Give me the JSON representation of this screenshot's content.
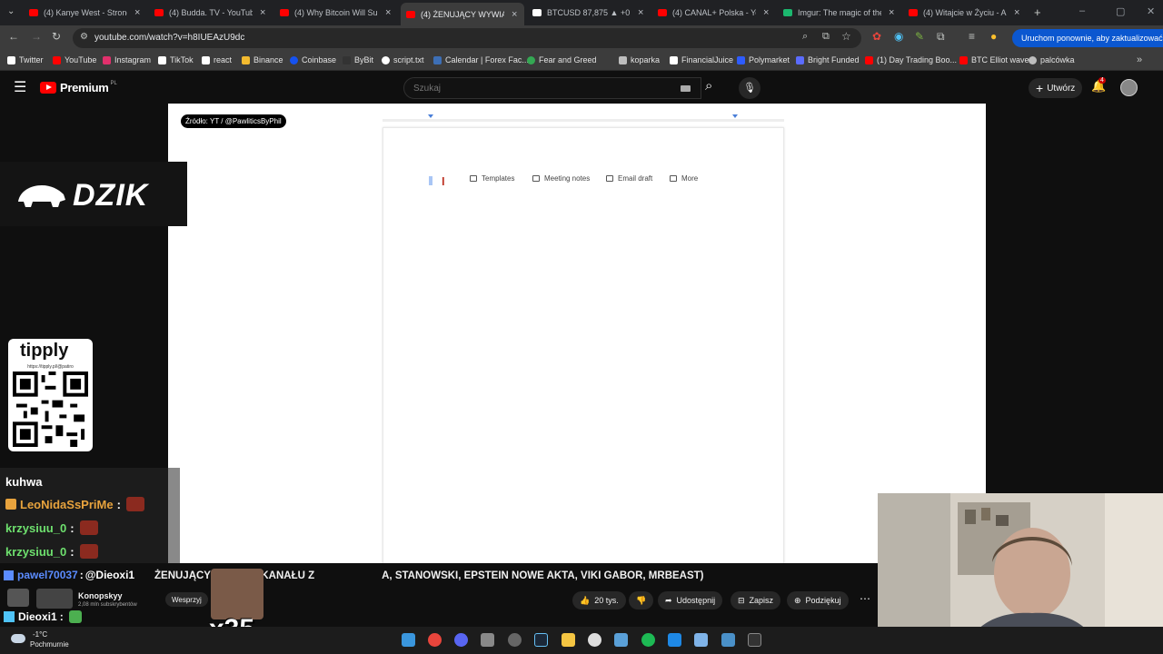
{
  "tabs": [
    {
      "title": "(4) Kanye West - Stronger",
      "color": "#ff0000"
    },
    {
      "title": "(4) Budda. TV - YouTube",
      "color": "#ff0000"
    },
    {
      "title": "(4) Why Bitcoin Will Surpass",
      "color": "#ff0000"
    },
    {
      "title": "(4) ŻENUJĄCY WYWIAD K",
      "color": "#ff0000"
    },
    {
      "title": "BTCUSD 87,875 ▲ +0.87%",
      "color": "#ffffff"
    },
    {
      "title": "(4) CANAL+ Polska - YouTube",
      "color": "#ff0000"
    },
    {
      "title": "Imgur: The magic of the Internet",
      "color": "#1bb76e"
    },
    {
      "title": "(4) Witajcie w Życiu - Ameryka",
      "color": "#ff0000"
    }
  ],
  "toolbar": {
    "url": "youtube.com/watch?v=h8IUEAzU9dc",
    "update_label": "Uruchom ponownie, aby zaktualizować"
  },
  "bookmarks": [
    {
      "label": "Twitter",
      "color": "#ffffff"
    },
    {
      "label": "YouTube",
      "color": "#ff0000"
    },
    {
      "label": "Instagram",
      "color": "#e1306c"
    },
    {
      "label": "TikTok",
      "color": "#ffffff"
    },
    {
      "label": "react",
      "color": "#ffffff"
    },
    {
      "label": "Binance",
      "color": "#f3ba2f"
    },
    {
      "label": "Coinbase",
      "color": "#1652f0"
    },
    {
      "label": "ByBit",
      "color": "#333333"
    },
    {
      "label": "script.txt",
      "color": "#ffffff"
    },
    {
      "label": "Calendar | Forex Fac...",
      "color": "#3d6fb6"
    },
    {
      "label": "Fear and Greed",
      "color": "#34a853"
    },
    {
      "label": "koparka",
      "color": "#bdbdbd"
    },
    {
      "label": "FinancialJuice",
      "color": "#ffffff"
    },
    {
      "label": "Polymarket",
      "color": "#2e5cff"
    },
    {
      "label": "Bright Funded",
      "color": "#5b6cff"
    },
    {
      "label": "(1) Day Trading Boo...",
      "color": "#ff0000"
    },
    {
      "label": "BTC Elliot wave",
      "color": "#ff0000"
    },
    {
      "label": "palcówka",
      "color": "#bdbdbd"
    }
  ],
  "youtube": {
    "logo_label": "Premium",
    "logo_region": "PL",
    "search_placeholder": "Szukaj",
    "create_label": "Utwórz",
    "notif_count": "4"
  },
  "video": {
    "source_tag": "Źródło: YT / @PawliticsByPhil",
    "chips": [
      "Templates",
      "Meeting notes",
      "Email draft",
      "More"
    ]
  },
  "overlays": {
    "dzik": "DZIK",
    "tipply": "tipply",
    "tipply_url": "https://tipply.pl/@patiro"
  },
  "chat": [
    {
      "user": "kuhwa",
      "sep": "",
      "color": "#ffffff"
    },
    {
      "user": "LeoNidaSsPriMe",
      "sep": ":",
      "color": "#e8a33d"
    },
    {
      "user": "krzysiuu_0",
      "sep": ":",
      "color": "#6ee06e"
    },
    {
      "user": "krzysiuu_0",
      "sep": ":",
      "color": "#6ee06e"
    },
    {
      "user": "pawel70037",
      "sep": ":",
      "mention": "@Dieoxi1",
      "color": "#5b8cff"
    },
    {
      "user": "Dieoxi1",
      "sep": ":",
      "color": "#ffffff"
    }
  ],
  "title_bar": {
    "title_part1": "ŻENUJĄCY WYWIAD KANAŁU Z",
    "title_part2": "A, STANOWSKI, EPSTEIN NOWE AKTA, VIKI GABOR, MRBEAST)",
    "channel": "Konopskyy",
    "subs": "2,08 mln subskrybentów",
    "support": "Wesprzyj",
    "likes": "20 tys.",
    "share": "Udostępnij",
    "save": "Zapisz",
    "thanks": "Podziękuj"
  },
  "x35_label": "x35",
  "taskbar": {
    "temp": "-1°C",
    "desc": "Pochmurnie"
  }
}
